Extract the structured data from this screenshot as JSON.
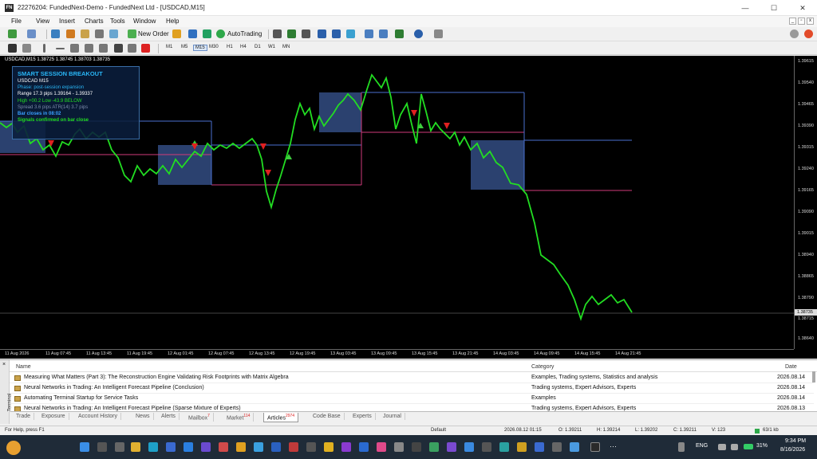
{
  "window": {
    "title": "22276204: FundedNext-Demo - FundedNext Ltd - [USDCAD,M15]"
  },
  "menu": [
    "File",
    "View",
    "Insert",
    "Charts",
    "Tools",
    "Window",
    "Help"
  ],
  "toolbar": {
    "new_order": "New Order",
    "autotrading": "AutoTrading"
  },
  "timeframes": [
    "M1",
    "M5",
    "M15",
    "M30",
    "H1",
    "H4",
    "D1",
    "W1",
    "MN"
  ],
  "chart": {
    "symbol_header": "USDCAD,M15  1.38725 1.38745 1.38703 1.38735",
    "current_price": "1.38735",
    "bid_price": "1.38715",
    "y_ticks": [
      "1.39615",
      "1.39540",
      "1.39465",
      "1.39390",
      "1.39315",
      "1.39240",
      "1.39165",
      "1.39090",
      "1.39015",
      "1.38940",
      "1.38865",
      "1.38790",
      "1.38640"
    ],
    "x_ticks": [
      "11 Aug 2026",
      "11 Aug 07:45",
      "11 Aug 13:45",
      "11 Aug 19:45",
      "12 Aug 01:45",
      "12 Aug 07:45",
      "12 Aug 13:45",
      "12 Aug 19:45",
      "13 Aug 03:45",
      "13 Aug 09:45",
      "13 Aug 15:45",
      "13 Aug 21:45",
      "14 Aug 03:45",
      "14 Aug 09:45",
      "14 Aug 15:45",
      "14 Aug 21:45"
    ],
    "info": {
      "title": "SMART SESSION BREAKOUT",
      "symbol": "USDCAD  M15",
      "phase": "Phase: post-session expansion",
      "range": "Range 17.3 pips   1.39164 - 1.39337",
      "high_low": "High +00.2   Low -43.9   BELOW",
      "spread": "Spread 3.6 pips   ATR(14) 3.7 pips",
      "bar_close": "Bar closes in 08:02",
      "signals": "Signals confirmed on bar close"
    }
  },
  "terminal": {
    "side_label": "Terminal",
    "headers": {
      "name": "Name",
      "category": "Category",
      "date": "Date"
    },
    "rows": [
      {
        "name": "Measuring What Matters (Part 3): The Reconstruction Engine  Validating Risk Footprints with Matrix Algebra",
        "category": "Examples, Trading systems, Statistics and analysis",
        "date": "2026.08.14"
      },
      {
        "name": "Neural Networks in Trading: An Intelligent Forecast Pipeline (Conclusion)",
        "category": "Trading systems, Expert Advisors, Experts",
        "date": "2026.08.14"
      },
      {
        "name": "Automating Terminal Startup for Service Tasks",
        "category": "Examples",
        "date": "2026.08.14"
      },
      {
        "name": "Neural Networks in Trading: An Intelligent Forecast Pipeline (Sparse Mixture of Experts)",
        "category": "Trading systems, Expert Advisors, Experts",
        "date": "2026.08.13"
      }
    ],
    "tabs": [
      {
        "label": "Trade",
        "badge": ""
      },
      {
        "label": "Exposure",
        "badge": ""
      },
      {
        "label": "Account History",
        "badge": ""
      },
      {
        "label": "News",
        "badge": ""
      },
      {
        "label": "Alerts",
        "badge": ""
      },
      {
        "label": "Mailbox",
        "badge": "7"
      },
      {
        "label": "Market",
        "badge": "114"
      },
      {
        "label": "Articles",
        "badge": "2974"
      },
      {
        "label": "Code Base",
        "badge": ""
      },
      {
        "label": "Experts",
        "badge": ""
      },
      {
        "label": "Journal",
        "badge": ""
      }
    ]
  },
  "status": {
    "help": "For Help, press F1",
    "profile": "Default",
    "time": "2026.08.12 01:15",
    "open": "O: 1.39211",
    "high": "H: 1.39214",
    "low": "L: 1.39202",
    "close": "C: 1.39211",
    "volume": "V: 123",
    "traffic": "63/1 kb"
  },
  "taskbar": {
    "lang": "ENG",
    "battery": "31%",
    "time": "9:34 PM",
    "date": "8/16/2026"
  }
}
